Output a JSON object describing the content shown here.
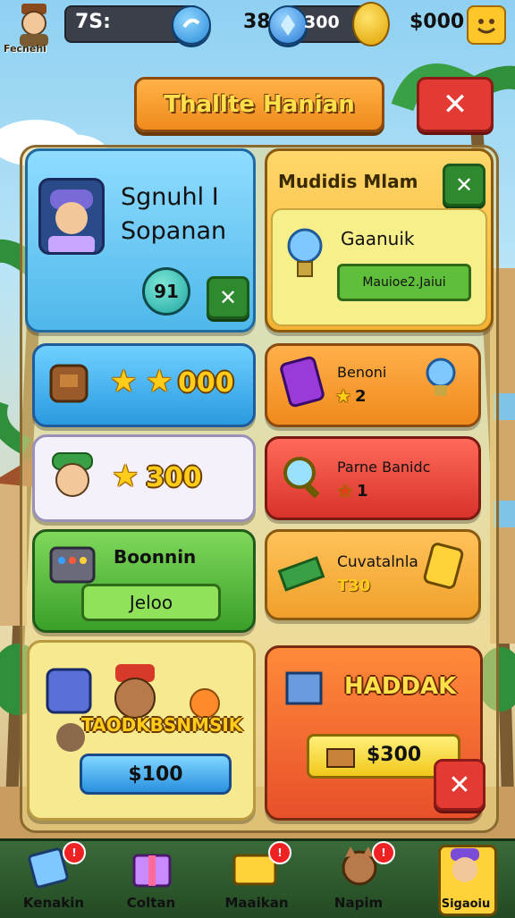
{
  "hud": {
    "player_label": "Fecnehi",
    "bar1_value": "7S:",
    "bar2_prefix": "38",
    "bar2_value": "300",
    "money_value": "$000"
  },
  "title_banner": {
    "text": "Thallte Hanian"
  },
  "profile_card": {
    "name_line1": "Sgnuhl I",
    "name_line2": "Sopanan",
    "level": "91"
  },
  "mission_card": {
    "title": "Mudidis Mlam",
    "item_name": "Gaanuik",
    "button_label": "Mauioe2.Jaiui"
  },
  "left_cards": [
    {
      "reward": "000"
    },
    {
      "reward": "300"
    },
    {
      "title": "Boonnin",
      "button_label": "Jeloo"
    },
    {
      "title": "TAODKBSNMSIK",
      "price": "$100"
    }
  ],
  "right_cards": [
    {
      "title": "Benoni",
      "count": "2"
    },
    {
      "title": "Parne Banidc",
      "count": "1"
    },
    {
      "title": "Cuvatalnla",
      "sub": "T30"
    },
    {
      "title": "HADDAK",
      "price": "$300"
    }
  ],
  "bottom_nav": [
    {
      "label": "Kenakin",
      "badge": ""
    },
    {
      "label": "Coltan",
      "badge": ""
    },
    {
      "label": "Maaikan",
      "badge": ""
    },
    {
      "label": "Napim",
      "badge": ""
    },
    {
      "label": "Sigaoiu",
      "badge": ""
    }
  ],
  "colors": {
    "blue_card": "#5cc6f0",
    "yellow_card": "#f6e36a",
    "orange_card": "#f59b2e",
    "red_card": "#e8483c",
    "green_card": "#5fbf3a",
    "white_card": "#f4f1fb"
  }
}
